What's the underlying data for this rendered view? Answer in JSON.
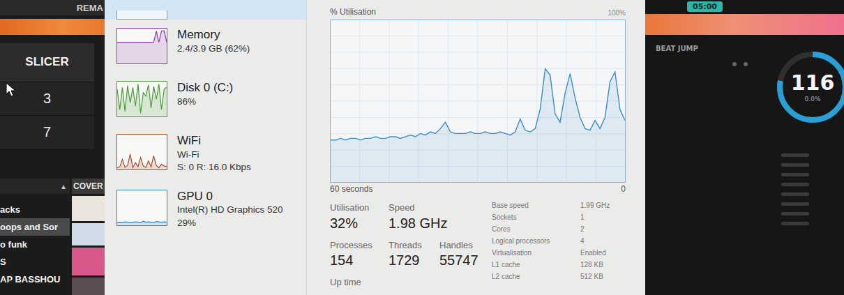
{
  "dj_left": {
    "header": "REMA",
    "pad_mode": "SLICER",
    "pads": [
      "3",
      "7"
    ],
    "library": {
      "sort_icon": "▲",
      "cover_header": "COVER",
      "items": [
        {
          "label": "acks",
          "selected": false
        },
        {
          "label": "oops and Sor",
          "selected": true
        },
        {
          "label": "o funk",
          "selected": false
        },
        {
          "label": "S",
          "selected": false
        },
        {
          "label": "AP BASSHOU",
          "selected": false
        }
      ],
      "covers": [
        {
          "color": "#e9e5dc"
        },
        {
          "color": "#cfdce8"
        },
        {
          "color": "#d9588a"
        },
        {
          "color": "#5c4c54"
        }
      ]
    }
  },
  "task_manager": {
    "selected_item_above": {
      "selected": true
    },
    "sidebar": {
      "items": [
        {
          "name": "Memory",
          "lines": [
            "2.4/3.9 GB (62%)"
          ],
          "color": "#8b3fa8",
          "selected": false,
          "values": [
            62,
            62,
            62,
            62,
            62,
            62,
            62,
            62,
            62,
            62,
            62,
            62,
            62,
            62,
            62,
            95,
            62,
            95,
            96,
            62
          ]
        },
        {
          "name": "Disk 0 (C:)",
          "lines": [
            "86%"
          ],
          "color": "#4a9a3a",
          "selected": false,
          "values": [
            80,
            20,
            85,
            15,
            90,
            40,
            85,
            30,
            95,
            10,
            70,
            60,
            92,
            25,
            88,
            50,
            95,
            20,
            80,
            86
          ]
        },
        {
          "name": "WiFi",
          "lines": [
            "Wi-Fi",
            "S: 0 R: 16.0 Kbps"
          ],
          "color": "#a0522d",
          "selected": false,
          "values": [
            5,
            8,
            30,
            6,
            12,
            45,
            5,
            20,
            8,
            35,
            10,
            6,
            25,
            8,
            40,
            12,
            5,
            15,
            10,
            9
          ]
        },
        {
          "name": "GPU 0",
          "lines": [
            "Intel(R) HD Graphics 520",
            "29%"
          ],
          "color": "#3c7fb1",
          "selected": false,
          "values": [
            8,
            9,
            8,
            10,
            9,
            8,
            9,
            10,
            9,
            8,
            12,
            9,
            10,
            9,
            8,
            11,
            10,
            9,
            10,
            9
          ]
        }
      ]
    },
    "chart": {
      "title": "% Utilisation",
      "max_label": "100%",
      "time_label": "60 seconds",
      "min_label": "0",
      "series": [
        {
          "name": "CPU",
          "color": "#3f8cc6",
          "values": [
            26,
            26,
            27,
            26,
            27,
            27,
            26,
            27,
            27,
            28,
            27,
            27,
            28,
            28,
            27,
            28,
            29,
            28,
            30,
            29,
            31,
            30,
            33,
            37,
            31,
            30,
            30,
            30,
            31,
            30,
            30,
            31,
            30,
            30,
            31,
            30,
            29,
            31,
            39,
            32,
            31,
            33,
            45,
            70,
            66,
            42,
            37,
            55,
            67,
            52,
            40,
            33,
            32,
            38,
            33,
            40,
            62,
            68,
            45,
            38
          ]
        }
      ]
    },
    "stats": [
      [
        {
          "label": "Utilisation",
          "value": "32%"
        },
        {
          "label": "Speed",
          "value": "1.98 GHz"
        }
      ],
      [
        {
          "label": "Processes",
          "value": "154"
        },
        {
          "label": "Threads",
          "value": "1729"
        },
        {
          "label": "Handles",
          "value": "55747"
        }
      ]
    ],
    "uptime_label": "Up time",
    "details": [
      {
        "label": "Base speed",
        "value": "1.99 GHz"
      },
      {
        "label": "Sockets",
        "value": "1"
      },
      {
        "label": "Cores",
        "value": "2"
      },
      {
        "label": "Logical processors",
        "value": "4"
      },
      {
        "label": "Virtualisation",
        "value": "Enabled"
      },
      {
        "label": "L1 cache",
        "value": "128 KB"
      },
      {
        "label": "L2 cache",
        "value": "512 KB"
      }
    ]
  },
  "dj_right": {
    "time": "05:00",
    "beat_jump": "BEAT JUMP",
    "bpm": "116",
    "pitch": "0.0%",
    "bpm_level": 0.78
  }
}
